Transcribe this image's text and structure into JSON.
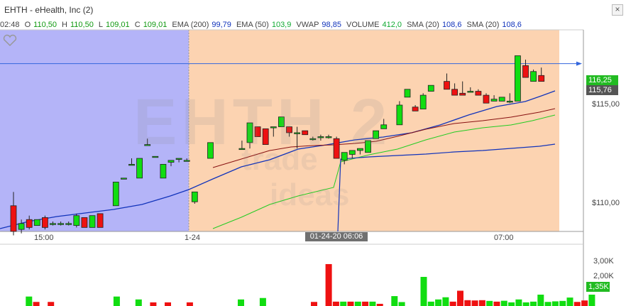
{
  "window": {
    "title": "EHTH - eHealth, Inc (2)",
    "close_label": "×"
  },
  "ohlc": {
    "time": "02:48",
    "open_label": "O",
    "open": "110,50",
    "high_label": "H",
    "high": "110,50",
    "low_label": "L",
    "low": "109,01",
    "close_label": "C",
    "close": "109,01"
  },
  "indicators": [
    {
      "label": "EMA (200)",
      "value": "99,79",
      "color": "#1133bb"
    },
    {
      "label": "EMA (50)",
      "value": "103,9",
      "color": "#11aa33"
    },
    {
      "label": "VWAP",
      "value": "98,85",
      "color": "#1133bb"
    },
    {
      "label": "VOLUME",
      "value": "412,0",
      "color": "#11aa33"
    },
    {
      "label": "SMA (20)",
      "value": "108,6",
      "color": "#1133bb"
    },
    {
      "label": "SMA (20)",
      "value": "108,6",
      "color": "#1133bb"
    }
  ],
  "watermark": {
    "symbol": "EHTH",
    "number": "2",
    "line1": "trade",
    "line2": "ideas"
  },
  "price_axis": {
    "ticks": [
      {
        "label": "$115,00",
        "price": 115.0
      },
      {
        "label": "$110,00",
        "price": 110.0
      }
    ],
    "last_price": {
      "label": "116,25",
      "price": 116.25,
      "color": "#22bb22"
    },
    "ref_price": {
      "label": "115,76",
      "price": 115.76,
      "color": "#555555"
    },
    "hline_price": 117.1
  },
  "time_axis": {
    "labels": [
      "15:00",
      "1-24",
      "07:00"
    ],
    "cursor_label": "01-24-20 06:06"
  },
  "volume_axis": {
    "ticks": [
      "3,00K",
      "2,00K"
    ],
    "current": "1,35K"
  },
  "colors": {
    "premarket_bg": "#b4b4f8",
    "session_bg": "#fcd3b1",
    "up_candle": "#11dd11",
    "down_candle": "#ee1111",
    "ema200": "#1133bb",
    "ema50": "#22cc22",
    "sma": "#881111",
    "vwap": "#1133bb"
  },
  "chart_data": {
    "type": "candlestick",
    "candles": [
      [
        109.9,
        110.6,
        108.4,
        108.6
      ],
      [
        108.7,
        109.2,
        108.5,
        109.0
      ],
      [
        109.2,
        109.4,
        108.7,
        108.8
      ],
      [
        108.9,
        109.2,
        108.9,
        109.2
      ],
      [
        109.3,
        109.4,
        108.7,
        108.8
      ],
      [
        109.0,
        109.1,
        108.9,
        109.0
      ],
      [
        109.0,
        109.1,
        108.9,
        109.0
      ],
      [
        109.0,
        109.1,
        108.9,
        109.0
      ],
      [
        108.9,
        109.5,
        108.8,
        109.4
      ],
      [
        109.3,
        109.3,
        108.8,
        108.8
      ],
      [
        108.8,
        109.4,
        108.8,
        109.4
      ],
      [
        109.5,
        109.5,
        108.8,
        108.8
      ],
      [
        null,
        null,
        null,
        null
      ],
      [
        109.9,
        111.1,
        109.9,
        111.1
      ],
      [
        111.3,
        111.3,
        111.3,
        111.3
      ],
      [
        112.0,
        112.3,
        112.0,
        112.0
      ],
      [
        111.3,
        112.3,
        111.3,
        112.3
      ],
      [
        113.0,
        113.3,
        113.0,
        113.0
      ],
      [
        112.4,
        112.4,
        112.4,
        112.4
      ],
      [
        111.3,
        112.0,
        111.3,
        112.0
      ],
      [
        112.1,
        112.2,
        111.9,
        112.2
      ],
      [
        112.3,
        112.3,
        112.1,
        112.3
      ],
      [
        112.2,
        112.3,
        112.2,
        112.2
      ],
      [
        110.1,
        110.6,
        110.0,
        110.6
      ],
      [
        null,
        null,
        null,
        null
      ],
      [
        112.3,
        113.1,
        112.3,
        113.1
      ],
      [
        null,
        null,
        null,
        null
      ],
      [
        null,
        null,
        null,
        null
      ],
      [
        null,
        null,
        null,
        null
      ],
      [
        112.8,
        113.2,
        112.8,
        112.8
      ],
      [
        113.1,
        114.1,
        112.8,
        114.1
      ],
      [
        113.9,
        113.9,
        113.4,
        113.4
      ],
      [
        113.8,
        113.8,
        113.0,
        113.0
      ],
      [
        113.9,
        113.9,
        113.4,
        113.9
      ],
      [
        113.9,
        114.4,
        113.9,
        114.4
      ],
      [
        113.9,
        113.9,
        113.4,
        113.6
      ],
      [
        113.6,
        113.9,
        112.8,
        113.6
      ],
      [
        113.7,
        113.7,
        113.5,
        113.5
      ],
      [
        113.3,
        113.4,
        113.2,
        113.3
      ],
      [
        113.4,
        113.5,
        113.2,
        113.4
      ],
      [
        113.4,
        113.5,
        113.3,
        113.4
      ],
      [
        113.3,
        113.4,
        112.3,
        112.3
      ],
      [
        112.2,
        112.2,
        112.0,
        112.6
      ],
      [
        112.5,
        112.7,
        112.3,
        112.7
      ],
      [
        112.7,
        112.8,
        112.5,
        112.8
      ],
      [
        112.6,
        113.2,
        112.6,
        113.2
      ],
      [
        113.3,
        113.7,
        113.3,
        113.7
      ],
      [
        113.8,
        114.3,
        113.8,
        114.0
      ],
      [
        null,
        null,
        null,
        null
      ],
      [
        114.0,
        115.2,
        114.0,
        115.0
      ],
      [
        115.4,
        115.8,
        115.4,
        115.8
      ],
      [
        114.9,
        115.0,
        114.7,
        114.7
      ],
      [
        114.8,
        115.6,
        114.8,
        115.5
      ],
      [
        115.7,
        116.0,
        115.7,
        116.0
      ],
      [
        null,
        null,
        null,
        null
      ],
      [
        116.2,
        116.6,
        115.8,
        115.8
      ],
      [
        115.8,
        116.1,
        115.5,
        115.5
      ],
      [
        115.6,
        116.2,
        115.5,
        115.5
      ],
      [
        115.7,
        115.9,
        115.7,
        115.7
      ],
      [
        115.7,
        115.8,
        115.6,
        115.5
      ],
      [
        115.5,
        115.6,
        115.1,
        115.1
      ],
      [
        115.2,
        115.5,
        115.2,
        115.3
      ],
      [
        115.2,
        115.4,
        115.2,
        115.4
      ],
      [
        115.2,
        115.6,
        115.1,
        115.2
      ],
      [
        115.2,
        117.5,
        115.2,
        117.5
      ],
      [
        117.0,
        117.3,
        116.4,
        116.4
      ],
      [
        116.2,
        116.8,
        116.2,
        116.7
      ],
      [
        116.5,
        116.9,
        116.2,
        116.2
      ]
    ],
    "volume": [
      [
        0,
        "g"
      ],
      [
        0.65,
        "g"
      ],
      [
        0.28,
        "r"
      ],
      [
        0,
        "g"
      ],
      [
        0.28,
        "r"
      ],
      [
        0,
        "g"
      ],
      [
        0,
        "g"
      ],
      [
        0,
        "g"
      ],
      [
        0,
        "g"
      ],
      [
        0.0,
        "r"
      ],
      [
        0,
        "g"
      ],
      [
        0,
        "g"
      ],
      [
        0,
        "g"
      ],
      [
        0.65,
        "g"
      ],
      [
        0,
        "g"
      ],
      [
        0,
        "g"
      ],
      [
        0.45,
        "g"
      ],
      [
        0,
        "g"
      ],
      [
        0.25,
        "r"
      ],
      [
        0,
        "g"
      ],
      [
        0.25,
        "r"
      ],
      [
        0,
        "g"
      ],
      [
        0,
        "g"
      ],
      [
        0.25,
        "r"
      ],
      [
        0,
        "g"
      ],
      [
        0.0,
        "g"
      ],
      [
        0,
        "g"
      ],
      [
        0,
        "g"
      ],
      [
        0,
        "g"
      ],
      [
        0,
        "g"
      ],
      [
        0.45,
        "g"
      ],
      [
        0,
        "g"
      ],
      [
        0,
        "g"
      ],
      [
        0.55,
        "g"
      ],
      [
        0,
        "g"
      ],
      [
        0,
        "g"
      ],
      [
        0,
        "g"
      ],
      [
        0,
        "g"
      ],
      [
        0,
        "g"
      ],
      [
        0,
        "g"
      ],
      [
        0.28,
        "r"
      ],
      [
        0,
        "g"
      ],
      [
        2.88,
        "r"
      ],
      [
        0.3,
        "r"
      ],
      [
        0.3,
        "g"
      ],
      [
        0.3,
        "r"
      ],
      [
        0.3,
        "g"
      ],
      [
        0.3,
        "r"
      ],
      [
        0.3,
        "g"
      ],
      [
        0.15,
        "r"
      ],
      [
        0,
        "g"
      ],
      [
        0.68,
        "g"
      ],
      [
        0.27,
        "g"
      ],
      [
        0,
        "g"
      ],
      [
        0,
        "g"
      ],
      [
        2.0,
        "g"
      ],
      [
        0.3,
        "g"
      ],
      [
        0.45,
        "g"
      ],
      [
        0.6,
        "g"
      ],
      [
        0.3,
        "r"
      ],
      [
        1.05,
        "r"
      ],
      [
        0.4,
        "r"
      ],
      [
        0.38,
        "r"
      ],
      [
        0.4,
        "r"
      ],
      [
        0.35,
        "g"
      ],
      [
        0.3,
        "r"
      ],
      [
        0.36,
        "g"
      ],
      [
        0.25,
        "g"
      ],
      [
        0.45,
        "g"
      ],
      [
        0.25,
        "g"
      ],
      [
        0.3,
        "g"
      ],
      [
        0.78,
        "g"
      ],
      [
        0.28,
        "g"
      ],
      [
        0.32,
        "g"
      ],
      [
        0.35,
        "g"
      ],
      [
        0.58,
        "g"
      ],
      [
        0.28,
        "r"
      ],
      [
        0.38,
        "r"
      ],
      [
        0.78,
        "g"
      ]
    ]
  }
}
